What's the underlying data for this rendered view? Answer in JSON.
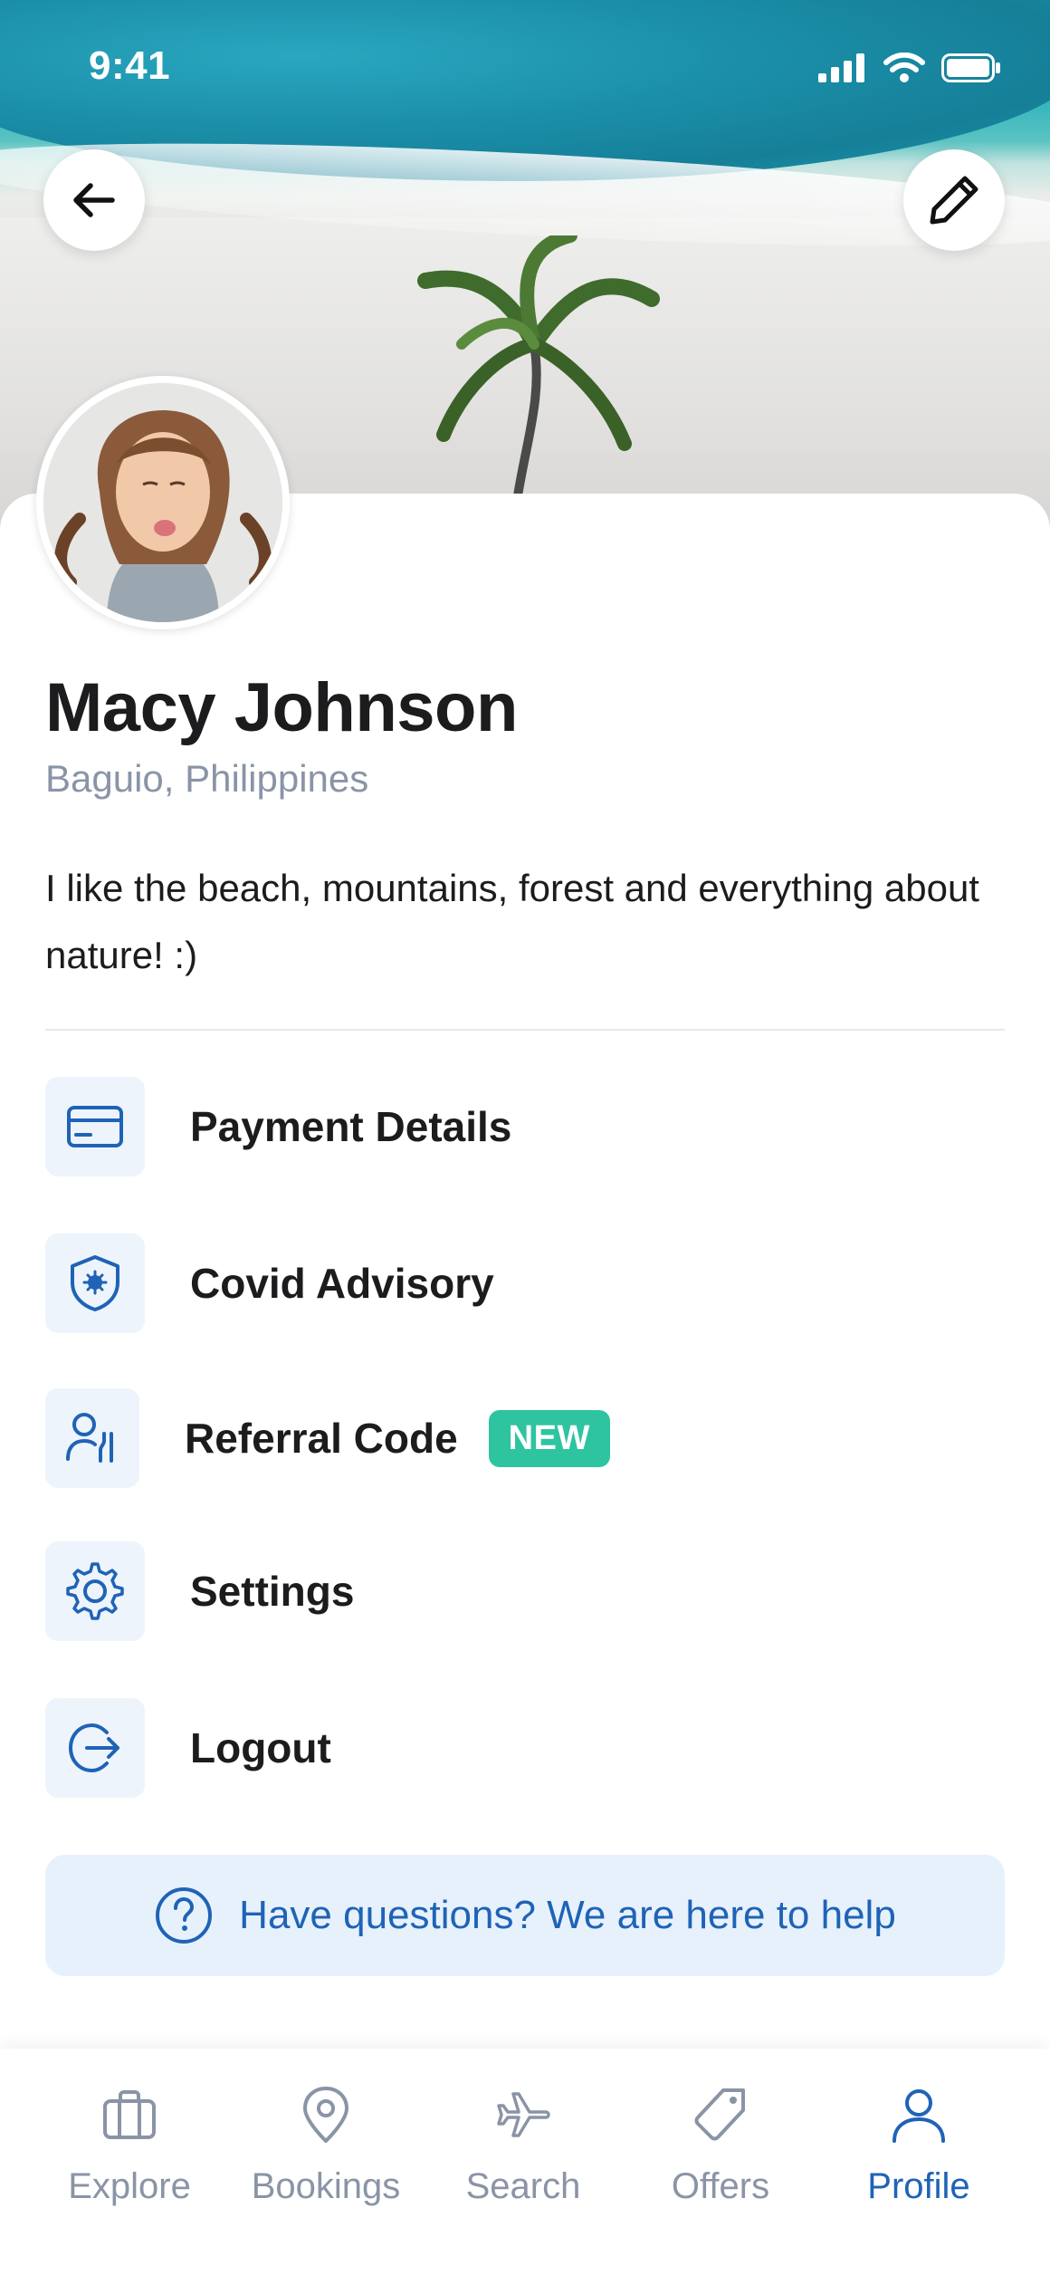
{
  "status_bar": {
    "time": "9:41"
  },
  "profile": {
    "name": "Macy Johnson",
    "location": "Baguio, Philippines",
    "bio": "I like the beach, mountains, forest and everything about nature! :)"
  },
  "menu": {
    "items": [
      {
        "label": "Payment Details",
        "icon": "credit-card-icon"
      },
      {
        "label": "Covid Advisory",
        "icon": "shield-virus-icon"
      },
      {
        "label": "Referral Code",
        "icon": "user-referral-icon",
        "badge": "NEW"
      },
      {
        "label": "Settings",
        "icon": "gear-icon"
      },
      {
        "label": "Logout",
        "icon": "logout-icon"
      }
    ]
  },
  "help": {
    "text": "Have questions? We are here to help"
  },
  "tabbar": {
    "items": [
      {
        "label": "Explore",
        "icon": "briefcase-icon",
        "active": false
      },
      {
        "label": "Bookings",
        "icon": "map-pin-icon",
        "active": false
      },
      {
        "label": "Search",
        "icon": "airplane-icon",
        "active": false
      },
      {
        "label": "Offers",
        "icon": "tag-icon",
        "active": false
      },
      {
        "label": "Profile",
        "icon": "user-icon",
        "active": true
      }
    ]
  },
  "colors": {
    "accent": "#1f63b6",
    "badge": "#2ec4a0",
    "menu_icon_bg": "#eef4fb",
    "help_bg": "#e7f1fc",
    "muted_text": "#8a94a6",
    "primary_text": "#1c1c1e"
  }
}
